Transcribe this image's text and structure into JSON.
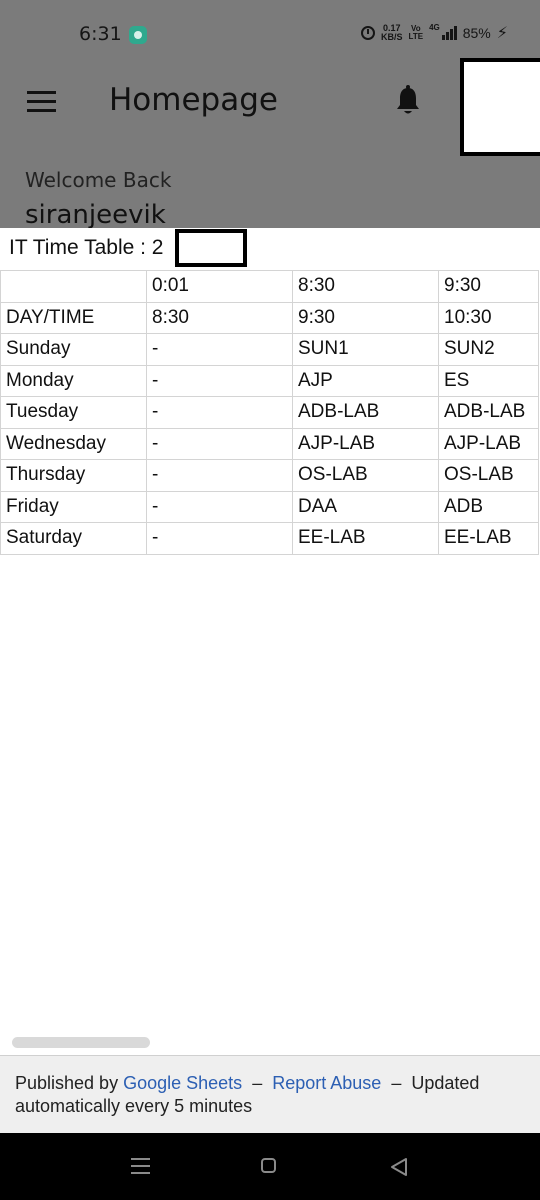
{
  "status_bar": {
    "time": "6:31",
    "net_speed_value": "0.17",
    "net_speed_unit": "KB/S",
    "volte_top": "Vo",
    "volte_bottom": "LTE",
    "network_type": "4G",
    "battery": "85%"
  },
  "header": {
    "title": "Homepage",
    "welcome": "Welcome Back",
    "username": "siranjeevik"
  },
  "sheet": {
    "title": "IT Time Table : 2"
  },
  "table": {
    "rows": [
      [
        "",
        "0:01",
        "8:30",
        "9:30"
      ],
      [
        "DAY/TIME",
        "8:30",
        "9:30",
        "10:30"
      ],
      [
        "Sunday",
        "-",
        "SUN1",
        "SUN2"
      ],
      [
        "Monday",
        "-",
        "AJP",
        "ES"
      ],
      [
        "Tuesday",
        "-",
        "ADB-LAB",
        "ADB-LAB"
      ],
      [
        "Wednesday",
        "-",
        "AJP-LAB",
        "AJP-LAB"
      ],
      [
        "Thursday",
        "-",
        "OS-LAB",
        "OS-LAB"
      ],
      [
        "Friday",
        "-",
        "DAA",
        "ADB"
      ],
      [
        "Saturday",
        "-",
        "EE-LAB",
        "EE-LAB"
      ]
    ]
  },
  "footer": {
    "published_by": "Published by",
    "google_sheets": "Google Sheets",
    "sep1": "–",
    "report_abuse": "Report Abuse",
    "sep2": "–",
    "updated": "Updated automatically every 5 minutes"
  },
  "colors": {
    "link": "#2c5fb3",
    "shade": "#7b7b7b",
    "nav_bar": "#000000"
  },
  "icons": [
    "menu-icon",
    "bell-icon",
    "alarm-icon",
    "recents-icon",
    "home-icon",
    "back-icon"
  ]
}
